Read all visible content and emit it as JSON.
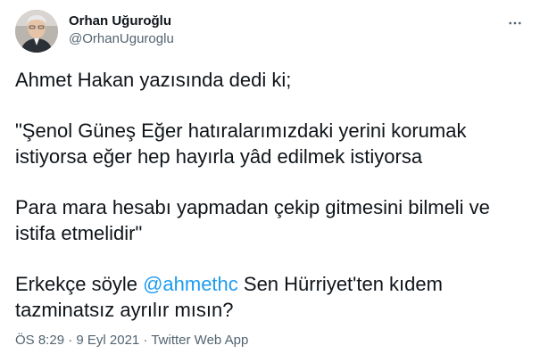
{
  "author": {
    "display_name": "Orhan Uğuroğlu",
    "handle": "@OrhanUguroglu",
    "avatar_icon": "user-avatar"
  },
  "more_icon": "more-horizontal-icon",
  "tweet": {
    "line1": "Ahmet Hakan yazısında dedi ki;",
    "para2": "\"Şenol Güneş Eğer hatıralarımızdaki yerini korumak\nistiyorsa eğer hep hayırla yâd edilmek istiyorsa",
    "para3": "Para mara hesabı yapmadan çekip gitmesini bilmeli ve\nistifa etmelidir\"",
    "para4_before": "Erkekçe söyle ",
    "para4_mention": "@ahmethc",
    "para4_after": " Sen Hürriyet'ten kıdem\ntazminatsız ayrılır mısın?"
  },
  "meta": {
    "time": "ÖS 8:29",
    "separator1": " · ",
    "date": "9 Eyl 2021",
    "separator2": " · ",
    "source": "Twitter Web App"
  },
  "colors": {
    "text": "#0f1419",
    "secondary": "#536471",
    "accent": "#1d9bf0"
  }
}
